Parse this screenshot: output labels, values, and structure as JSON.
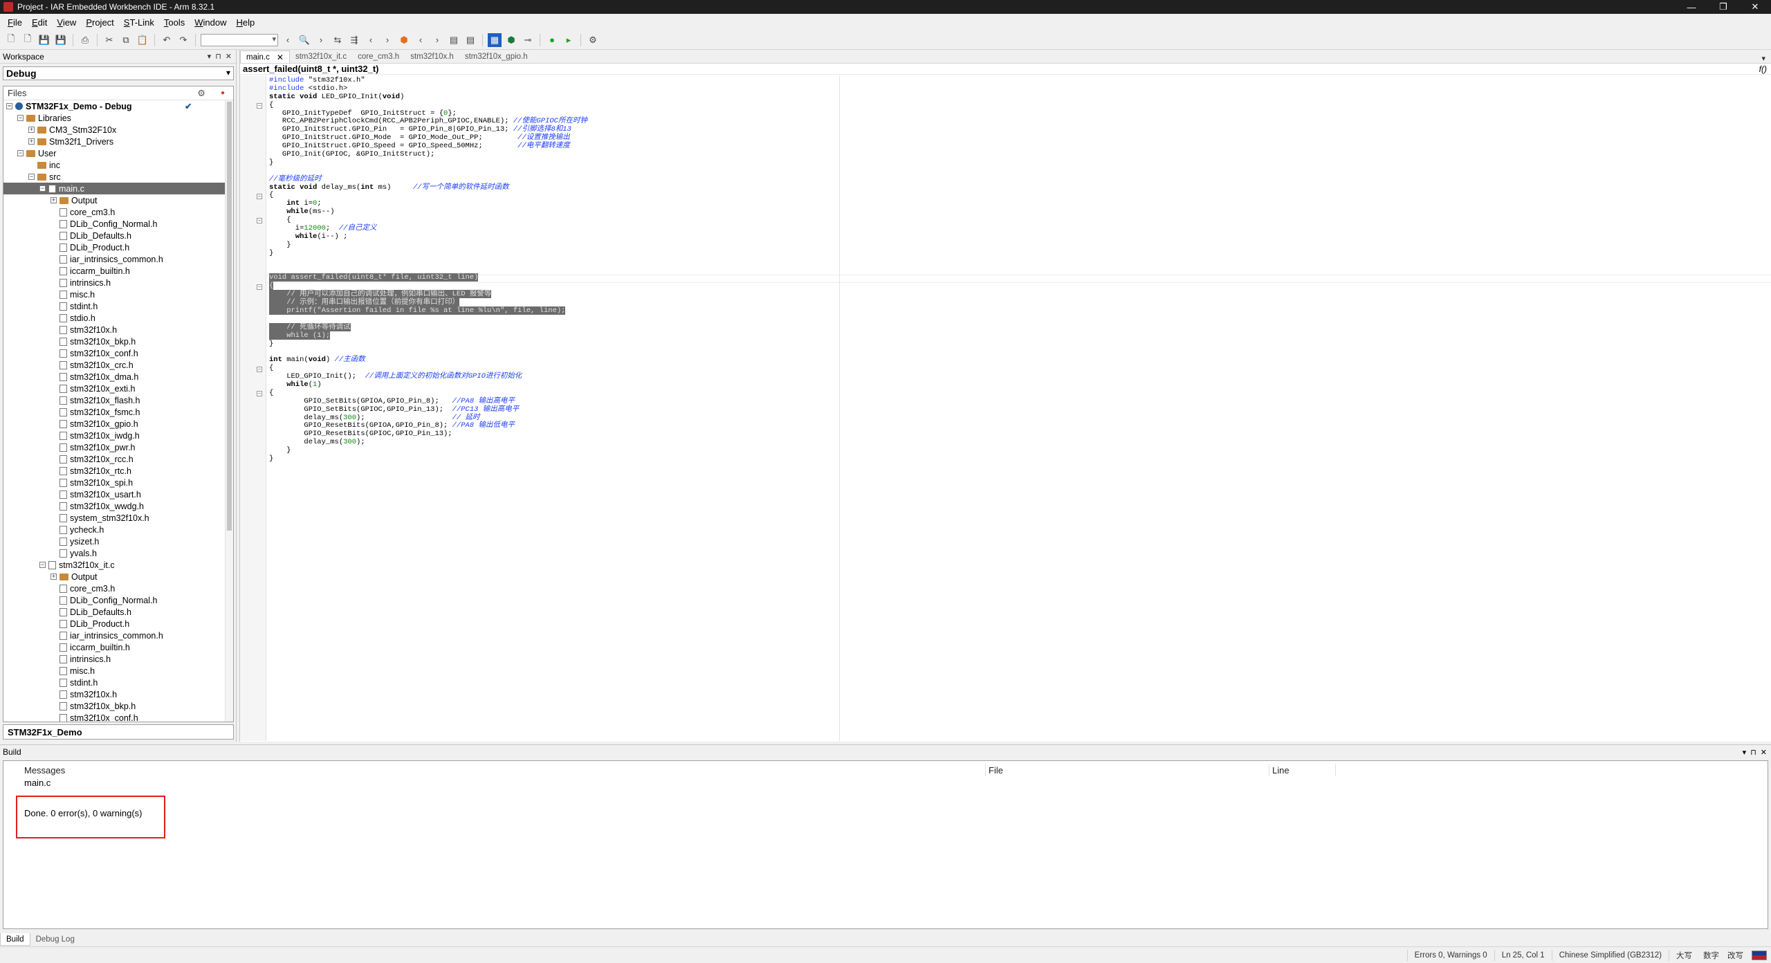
{
  "window": {
    "title": "Project - IAR Embedded Workbench IDE - Arm 8.32.1",
    "controls": [
      "—",
      "❐",
      "✕"
    ]
  },
  "menu": [
    "File",
    "Edit",
    "View",
    "Project",
    "ST-Link",
    "Tools",
    "Window",
    "Help"
  ],
  "workspace": {
    "header": "Workspace",
    "configuration": "Debug",
    "files_label": "Files",
    "tree": [
      {
        "label": "STM32F1x_Demo - Debug",
        "depth": 0,
        "kind": "project",
        "expander": "⊟",
        "bold": true,
        "check": "✔"
      },
      {
        "label": "Libraries",
        "depth": 1,
        "kind": "folder",
        "expander": "⊟"
      },
      {
        "label": "CM3_Stm32F10x",
        "depth": 2,
        "kind": "folder",
        "expander": "⊞"
      },
      {
        "label": "Stm32f1_Drivers",
        "depth": 2,
        "kind": "folder",
        "expander": "⊞"
      },
      {
        "label": "User",
        "depth": 1,
        "kind": "folder",
        "expander": "⊟"
      },
      {
        "label": "inc",
        "depth": 2,
        "kind": "folder",
        "expander": ""
      },
      {
        "label": "src",
        "depth": 2,
        "kind": "folder",
        "expander": "⊟"
      },
      {
        "label": "main.c",
        "depth": 3,
        "kind": "file",
        "expander": "⊟",
        "selected": true
      },
      {
        "label": "Output",
        "depth": 4,
        "kind": "folder",
        "expander": "⊞"
      },
      {
        "label": "core_cm3.h",
        "depth": 4,
        "kind": "file",
        "expander": ""
      },
      {
        "label": "DLib_Config_Normal.h",
        "depth": 4,
        "kind": "file",
        "expander": ""
      },
      {
        "label": "DLib_Defaults.h",
        "depth": 4,
        "kind": "file",
        "expander": ""
      },
      {
        "label": "DLib_Product.h",
        "depth": 4,
        "kind": "file",
        "expander": ""
      },
      {
        "label": "iar_intrinsics_common.h",
        "depth": 4,
        "kind": "file",
        "expander": ""
      },
      {
        "label": "iccarm_builtin.h",
        "depth": 4,
        "kind": "file",
        "expander": ""
      },
      {
        "label": "intrinsics.h",
        "depth": 4,
        "kind": "file",
        "expander": ""
      },
      {
        "label": "misc.h",
        "depth": 4,
        "kind": "file",
        "expander": ""
      },
      {
        "label": "stdint.h",
        "depth": 4,
        "kind": "file",
        "expander": ""
      },
      {
        "label": "stdio.h",
        "depth": 4,
        "kind": "file",
        "expander": ""
      },
      {
        "label": "stm32f10x.h",
        "depth": 4,
        "kind": "file",
        "expander": ""
      },
      {
        "label": "stm32f10x_bkp.h",
        "depth": 4,
        "kind": "file",
        "expander": ""
      },
      {
        "label": "stm32f10x_conf.h",
        "depth": 4,
        "kind": "file",
        "expander": ""
      },
      {
        "label": "stm32f10x_crc.h",
        "depth": 4,
        "kind": "file",
        "expander": ""
      },
      {
        "label": "stm32f10x_dma.h",
        "depth": 4,
        "kind": "file",
        "expander": ""
      },
      {
        "label": "stm32f10x_exti.h",
        "depth": 4,
        "kind": "file",
        "expander": ""
      },
      {
        "label": "stm32f10x_flash.h",
        "depth": 4,
        "kind": "file",
        "expander": ""
      },
      {
        "label": "stm32f10x_fsmc.h",
        "depth": 4,
        "kind": "file",
        "expander": ""
      },
      {
        "label": "stm32f10x_gpio.h",
        "depth": 4,
        "kind": "file",
        "expander": ""
      },
      {
        "label": "stm32f10x_iwdg.h",
        "depth": 4,
        "kind": "file",
        "expander": ""
      },
      {
        "label": "stm32f10x_pwr.h",
        "depth": 4,
        "kind": "file",
        "expander": ""
      },
      {
        "label": "stm32f10x_rcc.h",
        "depth": 4,
        "kind": "file",
        "expander": ""
      },
      {
        "label": "stm32f10x_rtc.h",
        "depth": 4,
        "kind": "file",
        "expander": ""
      },
      {
        "label": "stm32f10x_spi.h",
        "depth": 4,
        "kind": "file",
        "expander": ""
      },
      {
        "label": "stm32f10x_usart.h",
        "depth": 4,
        "kind": "file",
        "expander": ""
      },
      {
        "label": "stm32f10x_wwdg.h",
        "depth": 4,
        "kind": "file",
        "expander": ""
      },
      {
        "label": "system_stm32f10x.h",
        "depth": 4,
        "kind": "file",
        "expander": ""
      },
      {
        "label": "ycheck.h",
        "depth": 4,
        "kind": "file",
        "expander": ""
      },
      {
        "label": "ysizet.h",
        "depth": 4,
        "kind": "file",
        "expander": ""
      },
      {
        "label": "yvals.h",
        "depth": 4,
        "kind": "file",
        "expander": ""
      },
      {
        "label": "stm32f10x_it.c",
        "depth": 3,
        "kind": "file",
        "expander": "⊟"
      },
      {
        "label": "Output",
        "depth": 4,
        "kind": "folder",
        "expander": "⊞"
      },
      {
        "label": "core_cm3.h",
        "depth": 4,
        "kind": "file",
        "expander": ""
      },
      {
        "label": "DLib_Config_Normal.h",
        "depth": 4,
        "kind": "file",
        "expander": ""
      },
      {
        "label": "DLib_Defaults.h",
        "depth": 4,
        "kind": "file",
        "expander": ""
      },
      {
        "label": "DLib_Product.h",
        "depth": 4,
        "kind": "file",
        "expander": ""
      },
      {
        "label": "iar_intrinsics_common.h",
        "depth": 4,
        "kind": "file",
        "expander": ""
      },
      {
        "label": "iccarm_builtin.h",
        "depth": 4,
        "kind": "file",
        "expander": ""
      },
      {
        "label": "intrinsics.h",
        "depth": 4,
        "kind": "file",
        "expander": ""
      },
      {
        "label": "misc.h",
        "depth": 4,
        "kind": "file",
        "expander": ""
      },
      {
        "label": "stdint.h",
        "depth": 4,
        "kind": "file",
        "expander": ""
      },
      {
        "label": "stm32f10x.h",
        "depth": 4,
        "kind": "file",
        "expander": ""
      },
      {
        "label": "stm32f10x_bkp.h",
        "depth": 4,
        "kind": "file",
        "expander": ""
      },
      {
        "label": "stm32f10x_conf.h",
        "depth": 4,
        "kind": "file",
        "expander": ""
      }
    ],
    "bottom_tab": "STM32F1x_Demo"
  },
  "editor": {
    "tabs": [
      "main.c",
      "stm32f10x_it.c",
      "core_cm3.h",
      "stm32f10x.h",
      "stm32f10x_gpio.h"
    ],
    "active_tab": "main.c",
    "function_bar": "assert_failed(uint8_t *, uint32_t)",
    "code_lines": [
      "#include \"stm32f10x.h\"",
      "#include <stdio.h>",
      "static void LED_GPIO_Init(void)",
      "{",
      "   GPIO_InitTypeDef  GPIO_InitStruct = {0};",
      "   RCC_APB2PeriphClockCmd(RCC_APB2Periph_GPIOC,ENABLE); //使能GPIOC所在时钟",
      "   GPIO_InitStruct.GPIO_Pin   = GPIO_Pin_8|GPIO_Pin_13; //引脚选择8和13",
      "   GPIO_InitStruct.GPIO_Mode  = GPIO_Mode_Out_PP;        //设置推挽输出",
      "   GPIO_InitStruct.GPIO_Speed = GPIO_Speed_50MHz;        //电平翻转速度",
      "   GPIO_Init(GPIOC, &GPIO_InitStruct);",
      "}",
      "",
      "//毫秒级的延时",
      "static void delay_ms(int ms)     //写一个简单的软件延时函数",
      "{",
      "    int i=0;",
      "    while(ms--)",
      "    {",
      "      i=12000;  //自己定义",
      "      while(i--) ;",
      "    }",
      "}",
      "",
      "",
      "void assert_failed(uint8_t* file, uint32_t line)",
      "{",
      "    // 用户可以添加自己的调试处理，例如串口输出、LED 报警等",
      "    // 示例：用串口输出报错位置（前提你有串口打印）",
      "    printf(\"Assertion failed in file %s at line %lu\\n\", file, line);",
      "",
      "    // 死循环等待调试",
      "    while (1);",
      "}",
      "",
      "int main(void) //主函数",
      "{",
      "    LED_GPIO_Init();  //调用上面定义的初始化函数对GPIO进行初始化",
      "    while(1)",
      "{",
      "        GPIO_SetBits(GPIOA,GPIO_Pin_8);   //PA8 输出高电平",
      "        GPIO_SetBits(GPIOC,GPIO_Pin_13);  //PC13 输出高电平",
      "        delay_ms(300);                    // 延时",
      "        GPIO_ResetBits(GPIOA,GPIO_Pin_8); //PA8 输出低电平",
      "        GPIO_ResetBits(GPIOC,GPIO_Pin_13);",
      "        delay_ms(300);",
      "    }",
      "}"
    ]
  },
  "build": {
    "header": "Build",
    "columns": [
      "Messages",
      "File",
      "Line"
    ],
    "messages": [
      "main.c",
      "Done. 0 error(s), 0 warning(s)"
    ],
    "tabs": [
      "Build",
      "Debug Log"
    ]
  },
  "status": {
    "errors": "Errors 0, Warnings 0",
    "position": "Ln 25, Col 1",
    "encoding": "Chinese Simplified (GB2312)",
    "ime": [
      "大写",
      "数字",
      "改写"
    ]
  },
  "colors": {
    "titlebar": "#1f1f1f",
    "selection": "#6b6b6b",
    "comment": "#1c3df5",
    "number": "#0a8a0a",
    "highlight_box": "#e01e1e"
  }
}
